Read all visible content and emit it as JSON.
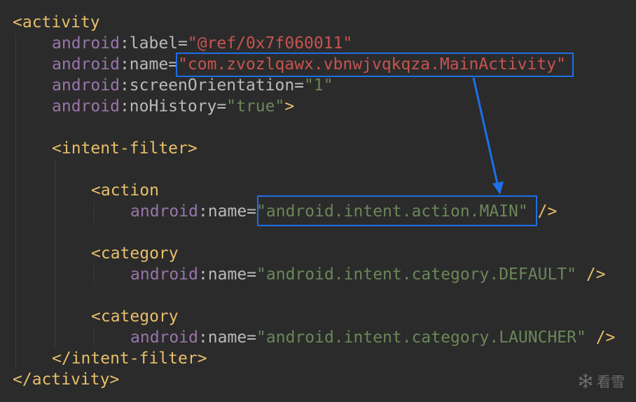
{
  "code": {
    "activity_open": "<activity",
    "label_ns": "android",
    "label_attr": ":label=",
    "label_value": "\"@ref/0x7f060011\"",
    "name_ns": "android",
    "name_attr": ":name=",
    "name_value": "\"com.zvozlqawx.vbnwjvqkqza.MainActivity\"",
    "orient_ns": "android",
    "orient_attr": ":screenOrientation=",
    "orient_value": "\"1\"",
    "nohist_ns": "android",
    "nohist_attr": ":noHistory=",
    "nohist_value": "\"true\"",
    "nohist_close": ">",
    "intent_filter_open": "<intent-filter>",
    "action_open": "<action",
    "action_ns": "android",
    "action_attr": ":name=",
    "action_value": "\"android.intent.action.MAIN\"",
    "action_close": " />",
    "category1_open": "<category",
    "category1_ns": "android",
    "category1_attr": ":name=",
    "category1_value": "\"android.intent.category.DEFAULT\"",
    "category1_close": " />",
    "category2_open": "<category",
    "category2_ns": "android",
    "category2_attr": ":name=",
    "category2_value": "\"android.intent.category.LAUNCHER\"",
    "category2_close": " />",
    "intent_filter_close": "</intent-filter>",
    "activity_close": "</activity>"
  },
  "watermark": {
    "icon": "snowflake-icon",
    "text": "看雪"
  },
  "colors": {
    "background": "#2b2b2b",
    "tag": "#e8bf6a",
    "namespace": "#9876aa",
    "attribute": "#bababa",
    "string": "#6a8759",
    "error_string": "#c75450",
    "highlight": "#1e6fe8"
  }
}
